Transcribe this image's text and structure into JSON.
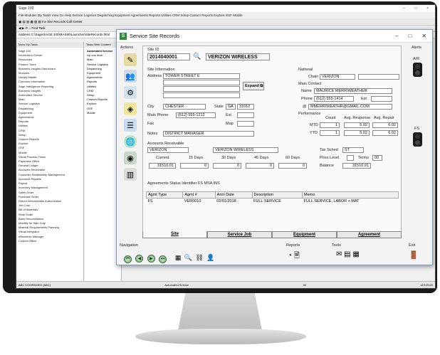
{
  "app": {
    "title": "Sage 100",
    "menu": "File  Modules  My Tasks  View  Go  Help  Service Logistics  Dispatching  Equipment  Agreements  Reports  Utilities  CRM  Setup  Custom Reports  Explore  OSF  Mobile",
    "toolbar_text": "Inv Site Records   Call Center",
    "find_task": "Find Task",
    "address": "Address  C:\\Sage\\SAGE 100\\MAS90\\Launcher\\SiteRecords.html",
    "left_tabs": "Tasks   My Tasks",
    "tree": [
      "Sage 100",
      "Information Center",
      "Resources",
      "Feature Tours",
      "Business Insights Dashboard",
      "Modules",
      "Library Master",
      "Common Information",
      "Sage Intelligence Reporting",
      "Business Insights",
      "Automated Service",
      "Main",
      "Service Logistics",
      "Dispatching",
      "Equipment",
      "Agreements",
      "Reports",
      "Utilities",
      "CRM",
      "Setup",
      "Custom Reports",
      "Explore",
      "OSF",
      "Mobile",
      "Visual Process Flows",
      "Paperless Office",
      "General Ledger",
      "Accounts Receivable",
      "Customer Relationship Management",
      "Accounts Payable",
      "Payroll",
      "Inventory Management",
      "Sales Order",
      "Purchase Order",
      "Return Merchandise Authorization",
      "Job Cost",
      "Bill of Materials",
      "Work Order",
      "Bank Reconciliation",
      "Mobility for Sale Cnty",
      "Material Requirements Planning",
      "Visual Integrator",
      "eBusiness Manager",
      "Custom Office"
    ],
    "mid_tabs": "Tasks   Web Content",
    "mid_header": "Automated Service",
    "mid_list": [
      "Up one level",
      "Main",
      "Service Logistics",
      "Dispatching",
      "Equipment",
      "Agreements",
      "Reports",
      "Utilities",
      "CRM",
      "Setup",
      "Custom Reports",
      "Explore",
      "OSF",
      "Mobile"
    ],
    "status_left": "ABC COMPANIES (ABC)",
    "status_mid": "Automated Service",
    "status_num": "40",
    "status_date": "12/1/2020"
  },
  "dialog": {
    "title": "Service Site Records",
    "actions_label": "Actions",
    "site_id_label": "Site ID",
    "site_id": "2014040001",
    "site_name": "VERIZON WIRELESS",
    "alerts_label": "Alerts",
    "alerts_ar": "A/R",
    "alerts_fs": "FS",
    "site_info": {
      "section": "Site Information",
      "address_label": "Address",
      "address1": "TOWER STREET E",
      "expand_label": "Expand",
      "city_label": "City",
      "city": "CHESTER",
      "state_label": "State",
      "state": "GA",
      "zip": "31012",
      "main_phone_label": "Main Phone",
      "main_phone": "(612) 555-1212",
      "ext_label": "Ext",
      "fax_label": "Fax",
      "map_label": "Map",
      "notes_label": "Notes",
      "notes": "DISTRICT MANAGER"
    },
    "national": {
      "section": "National",
      "chain_label": "Chain",
      "chain": "VERIZON"
    },
    "main_contact": {
      "section": "Main Contact",
      "name_label": "Name",
      "name": "MAURICE MERRIWEATHER",
      "phone_label": "Phone",
      "phone": "(612) 555-1414",
      "ext_label": "Ext",
      "email_label": "@",
      "email": "MMERRIWEATHR@GMAIL.COM"
    },
    "performance": {
      "section": "Performance",
      "count_label": "Count",
      "avg_response_label": "Avg. Response",
      "avg_repair_label": "Avg. Repair",
      "mtd_label": "MTD",
      "mtd_count": "1",
      "mtd_response": "5.02",
      "mtd_repair": "6.02",
      "ytd_label": "YTD",
      "ytd_count": "1",
      "ytd_response": "5.02",
      "ytd_repair": "6.02"
    },
    "ar": {
      "section": "Accounts Receivable",
      "customer_no": "VERIZON",
      "customer_name": "VERIZON WIRELESS",
      "tax_sched_label": "Tax Sched",
      "tax_sched": "ST",
      "current_label": "Current",
      "days15_label": "15 Days",
      "days30_label": "30 Days",
      "days45_label": "45 Days",
      "days60_label": "60 Days",
      "current": "31510.01",
      "days15": "0",
      "days30": "0",
      "days45": "0",
      "days60": "0",
      "price_level_label": "Price Level",
      "terms_label": "Terms",
      "terms": "00",
      "balance_label": "Balance",
      "balance": "31510.01"
    },
    "agreements": {
      "section": "Agreements Status Identifier  FS  MSA INS",
      "headers": [
        "Agmt Type",
        "Agmt #",
        "Anni Date",
        "Description",
        "Memo"
      ],
      "rows": [
        [
          "FS",
          "VER0010",
          "02/01/2018",
          "FULL SERVICE",
          "FULL SERVICE, LABOR + MAT"
        ]
      ]
    },
    "tabs": [
      "Site",
      "Service Job",
      "Equipment",
      "Agreement"
    ],
    "navigation_label": "Navigation",
    "reports_label": "Reports",
    "tools_label": "Tools",
    "exit_label": "Exit"
  },
  "colors": {
    "accent": "#2e8b3a",
    "dialog_border": "#7a9cc6"
  }
}
